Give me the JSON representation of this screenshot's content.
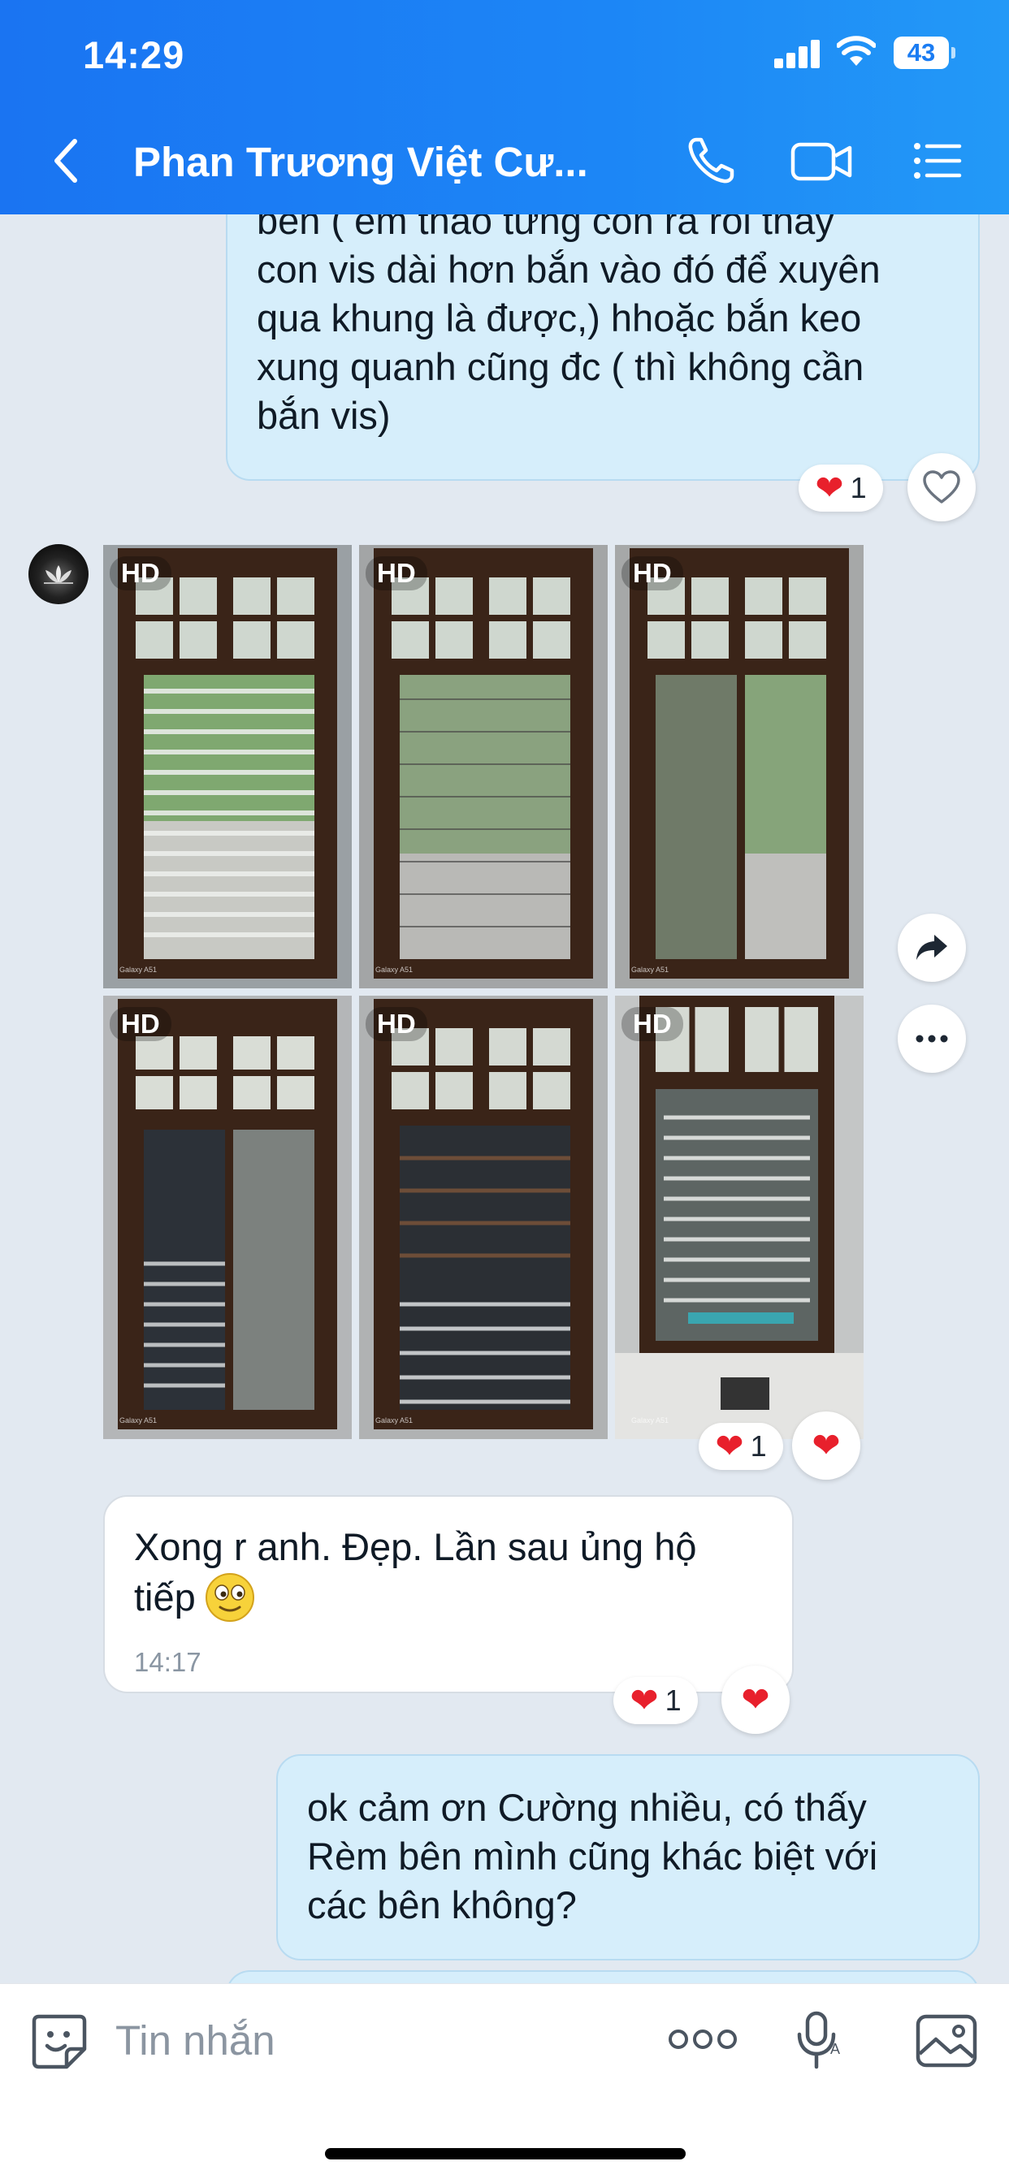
{
  "status_bar": {
    "time": "14:29",
    "battery": "43"
  },
  "header": {
    "title": "Phan Trương Việt Cư...",
    "icons": [
      "back-icon",
      "phone-icon",
      "video-icon",
      "list-icon"
    ]
  },
  "messages": {
    "m1": {
      "lines": [
        "bên ( em tháo từng con ra rồi thay",
        "con vis dài hơn bắn vào đó để xuyên",
        "qua khung là được,) hhoặc bắn keo",
        "xung quanh cũng đc ( thì không cần",
        "bắn vis)"
      ],
      "reaction": {
        "emoji": "heart",
        "count": "1"
      }
    },
    "photos": {
      "badge": "HD",
      "camera_tag": "Galaxy A51",
      "reaction": {
        "emoji": "heart",
        "count": "1"
      }
    },
    "m2": {
      "line1": "Xong r anh. Đẹp. Lần sau ủng hộ",
      "line2": "tiếp",
      "time": "14:17",
      "reaction": {
        "emoji": "heart",
        "count": "1"
      }
    },
    "m3": {
      "lines": [
        "ok cảm ơn Cường nhiều, có thấy",
        "Rèm bên mình cũng khác biệt với",
        "các bên không?"
      ]
    }
  },
  "input_bar": {
    "placeholder": "Tin nhắn"
  },
  "colors": {
    "header": "#1a7cf3",
    "outgoing_bubble": "#d6eefb",
    "reaction_heart": "#e8202c"
  }
}
